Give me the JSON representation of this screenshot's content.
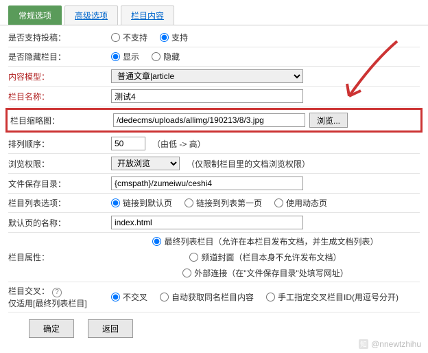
{
  "tabs": {
    "general": "常规选项",
    "advanced": "高级选项",
    "content": "栏目内容"
  },
  "rows": {
    "submit": {
      "label": "是否支持投稿：",
      "opt1": "不支持",
      "opt2": "支持"
    },
    "hidden": {
      "label": "是否隐藏栏目：",
      "opt1": "显示",
      "opt2": "隐藏"
    },
    "model": {
      "label": "内容模型：",
      "value": "普通文章|article"
    },
    "name": {
      "label": "栏目名称：",
      "value": "测试4"
    },
    "thumb": {
      "label": "栏目缩略图：",
      "value": "/dedecms/uploads/allimg/190213/8/3.jpg",
      "browse": "浏览..."
    },
    "order": {
      "label": "排列顺序：",
      "value": "50",
      "hint": "（由低 -> 高）"
    },
    "perm": {
      "label": "浏览权限：",
      "value": "开放浏览",
      "hint": "（仅限制栏目里的文档浏览权限）"
    },
    "savepath": {
      "label": "文件保存目录：",
      "value": "{cmspath}/zumeiwu/ceshi4"
    },
    "listopt": {
      "label": "栏目列表选项：",
      "opt1": "链接到默认页",
      "opt2": "链接到列表第一页",
      "opt3": "使用动态页"
    },
    "default": {
      "label": "默认页的名称：",
      "value": "index.html"
    },
    "attr": {
      "label": "栏目属性：",
      "opt1": "最终列表栏目（允许在本栏目发布文档，并生成文档列表）",
      "opt2": "频道封面（栏目本身不允许发布文档）",
      "opt3": "外部连接（在\"文件保存目录\"处填写网址）"
    },
    "cross": {
      "label": "栏目交叉：",
      "sub": "仅适用[最终列表栏目]",
      "opt1": "不交叉",
      "opt2": "自动获取同名栏目内容",
      "opt3": "手工指定交叉栏目ID(用逗号分开)"
    }
  },
  "footer": {
    "ok": "确定",
    "back": "返回"
  },
  "watermark": "@nnewtzhihu"
}
